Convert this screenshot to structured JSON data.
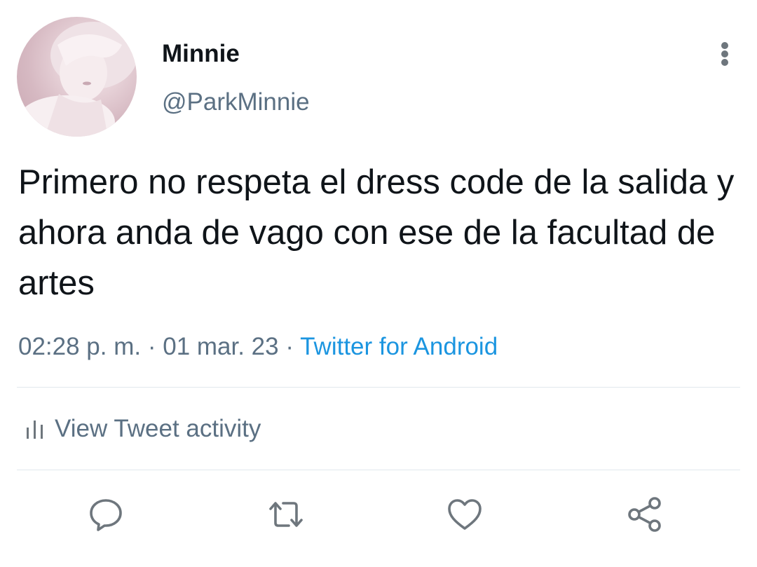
{
  "tweet": {
    "display_name": "Minnie",
    "handle": "@ParkMinnie",
    "text": "Primero no respeta el dress code de la salida y ahora anda de vago con ese de la facultad de artes",
    "time": "02:28 p. m.",
    "date": "01 mar. 23",
    "separator": "·",
    "source": "Twitter for Android"
  },
  "activity": {
    "label": "View Tweet activity",
    "icon": "bar-chart-icon"
  },
  "actions": [
    {
      "name": "reply",
      "icon": "comment-icon"
    },
    {
      "name": "retweet",
      "icon": "retweet-icon"
    },
    {
      "name": "like",
      "icon": "heart-icon"
    },
    {
      "name": "share",
      "icon": "share-icon"
    }
  ],
  "colors": {
    "text": "#0f1419",
    "secondary": "#5b7083",
    "link": "#1b95e0",
    "divider": "#e1e8ed",
    "icon": "#6e767d"
  }
}
